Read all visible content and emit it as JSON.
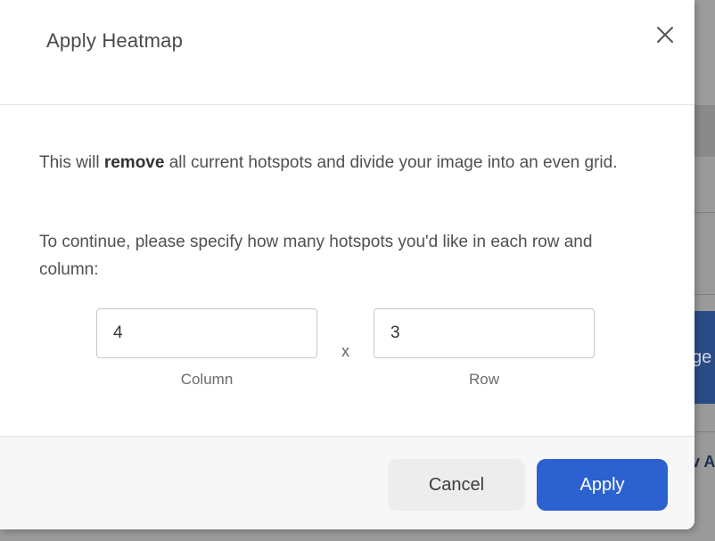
{
  "dialog": {
    "title": "Apply Heatmap",
    "body": {
      "line1_prefix": "This will ",
      "line1_bold": "remove",
      "line1_suffix": " all current hotspots and divide your image into an even grid.",
      "line2": "To continue, please specify how many hotspots you'd like in each row and column:"
    },
    "fields": {
      "column": {
        "value": "4",
        "label": "Column"
      },
      "row": {
        "value": "3",
        "label": "Row"
      },
      "separator": "x"
    },
    "buttons": {
      "cancel": "Cancel",
      "apply": "Apply"
    }
  },
  "background": {
    "blue_fragment": "ge",
    "link_fragment": "v A"
  },
  "colors": {
    "primary": "#2c62cf",
    "cancel_bg": "#ededed",
    "footer_bg": "#f7f7f7"
  },
  "icons": {
    "close": "close-icon"
  }
}
